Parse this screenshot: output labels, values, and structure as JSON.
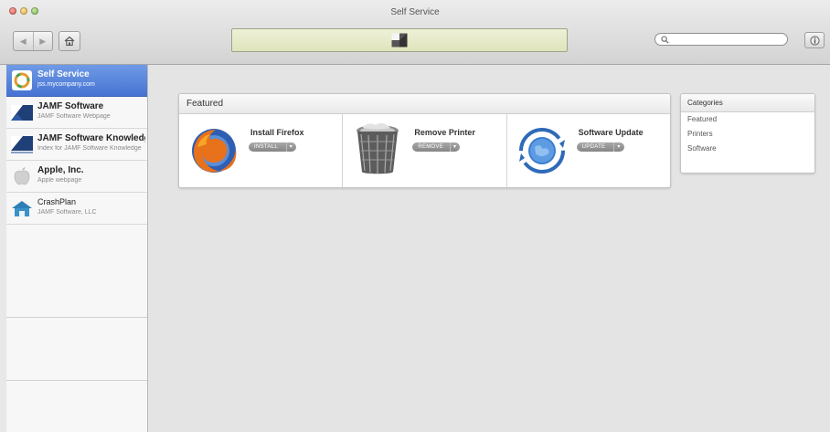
{
  "window": {
    "title": "Self Service"
  },
  "toolbar": {
    "back_glyph": "◀",
    "forward_glyph": "▶",
    "search_placeholder": "",
    "info_glyph": "i"
  },
  "sidebar": {
    "items": [
      {
        "title": "Self Service",
        "subtitle": "jss.mycompany.com",
        "icon": "self-service-icon",
        "selected": true
      },
      {
        "title": "JAMF Software",
        "subtitle": "JAMF Software Webpage",
        "icon": "jamf-logo-icon",
        "selected": false
      },
      {
        "title": "JAMF Software Knowledge",
        "subtitle": "Index for JAMF Software Knowledge",
        "icon": "jamf-knowledge-icon",
        "selected": false
      },
      {
        "title": "Apple, Inc.",
        "subtitle": "Apple webpage",
        "icon": "apple-logo-icon",
        "selected": false
      },
      {
        "title": "CrashPlan",
        "subtitle": "JAMF Software, LLC",
        "icon": "crashplan-icon",
        "selected": false
      }
    ]
  },
  "featured": {
    "heading": "Featured",
    "items": [
      {
        "name": "Install Firefox",
        "action": "INSTALL",
        "icon": "firefox-icon"
      },
      {
        "name": "Remove Printer",
        "action": "REMOVE",
        "icon": "trash-icon"
      },
      {
        "name": "Software Update",
        "action": "UPDATE",
        "icon": "software-update-icon"
      }
    ]
  },
  "categories": {
    "heading": "Categories",
    "items": [
      "Featured",
      "Printers",
      "Software"
    ]
  },
  "colors": {
    "selection": "#4f7dd9",
    "status_area": "#e6ead0",
    "action_pill": "#999999"
  }
}
